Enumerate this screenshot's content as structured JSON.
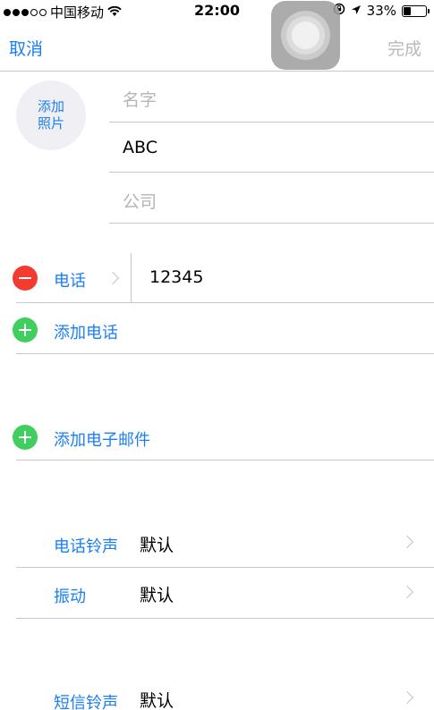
{
  "status": {
    "carrier": "中国移动",
    "time": "22:00",
    "battery": "33%",
    "battery_level": 0.33
  },
  "nav": {
    "cancel": "取消",
    "done": "完成"
  },
  "photo": {
    "line1": "添加",
    "line2": "照片"
  },
  "name": {
    "first_placeholder": "名字",
    "last_value": "ABC",
    "company_placeholder": "公司"
  },
  "phone": {
    "label": "电话",
    "value": "12345",
    "add_label": "添加电话"
  },
  "email": {
    "add_label": "添加电子邮件"
  },
  "ringtone": {
    "label": "电话铃声",
    "value": "默认"
  },
  "vibration": {
    "label": "振动",
    "value": "默认"
  },
  "text_tone": {
    "label": "短信铃声",
    "value": "默认"
  }
}
